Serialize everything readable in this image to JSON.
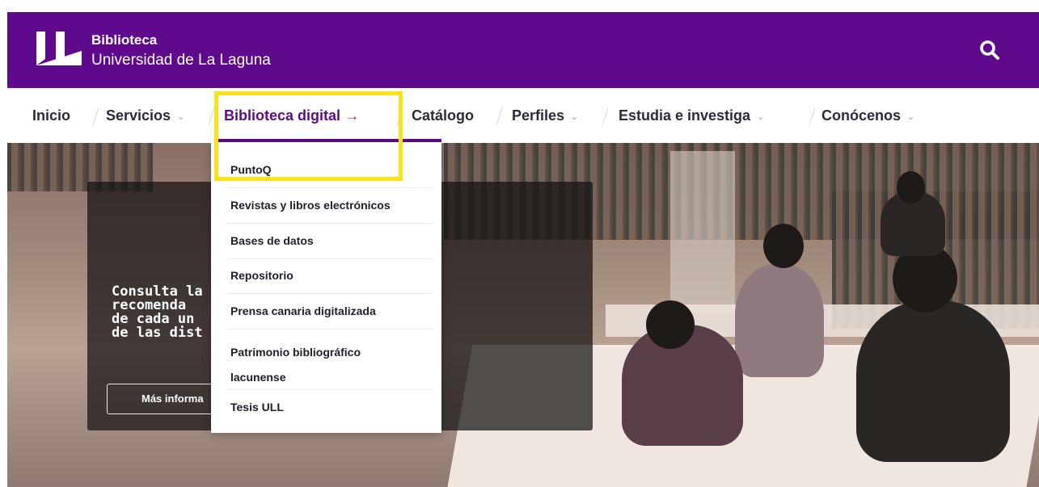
{
  "header": {
    "brand_line1": "Biblioteca",
    "brand_line2": "Universidad de La Laguna",
    "background": "#5f0a8c",
    "search_icon": "search-icon"
  },
  "nav": {
    "items": [
      {
        "label": "Inicio",
        "has_dropdown": false
      },
      {
        "label": "Servicios",
        "has_dropdown": true
      },
      {
        "label": "Biblioteca digital",
        "has_dropdown": false,
        "active": true,
        "arrow": "→"
      },
      {
        "label": "Catálogo",
        "has_dropdown": false
      },
      {
        "label": "Perfiles",
        "has_dropdown": true
      },
      {
        "label": "Estudia e investiga",
        "has_dropdown": true
      },
      {
        "label": "Conócenos",
        "has_dropdown": true
      }
    ],
    "chevron": "⌄",
    "active_color": "#5f0a8c"
  },
  "dropdown": {
    "items": [
      {
        "label": "PuntoQ"
      },
      {
        "label": "Revistas y libros electrónicos"
      },
      {
        "label": "Bases de datos"
      },
      {
        "label": "Repositorio"
      },
      {
        "label": "Prensa canaria digitalizada"
      },
      {
        "label": "Patrimonio bibliográfico\nlacunense"
      },
      {
        "label": "Tesis ULL"
      }
    ]
  },
  "hero": {
    "promo_text": "Consulta la\nrecomenda\nde cada un\nde las dist",
    "promo_button": "Más informa"
  },
  "highlight_color": "#fbe315"
}
